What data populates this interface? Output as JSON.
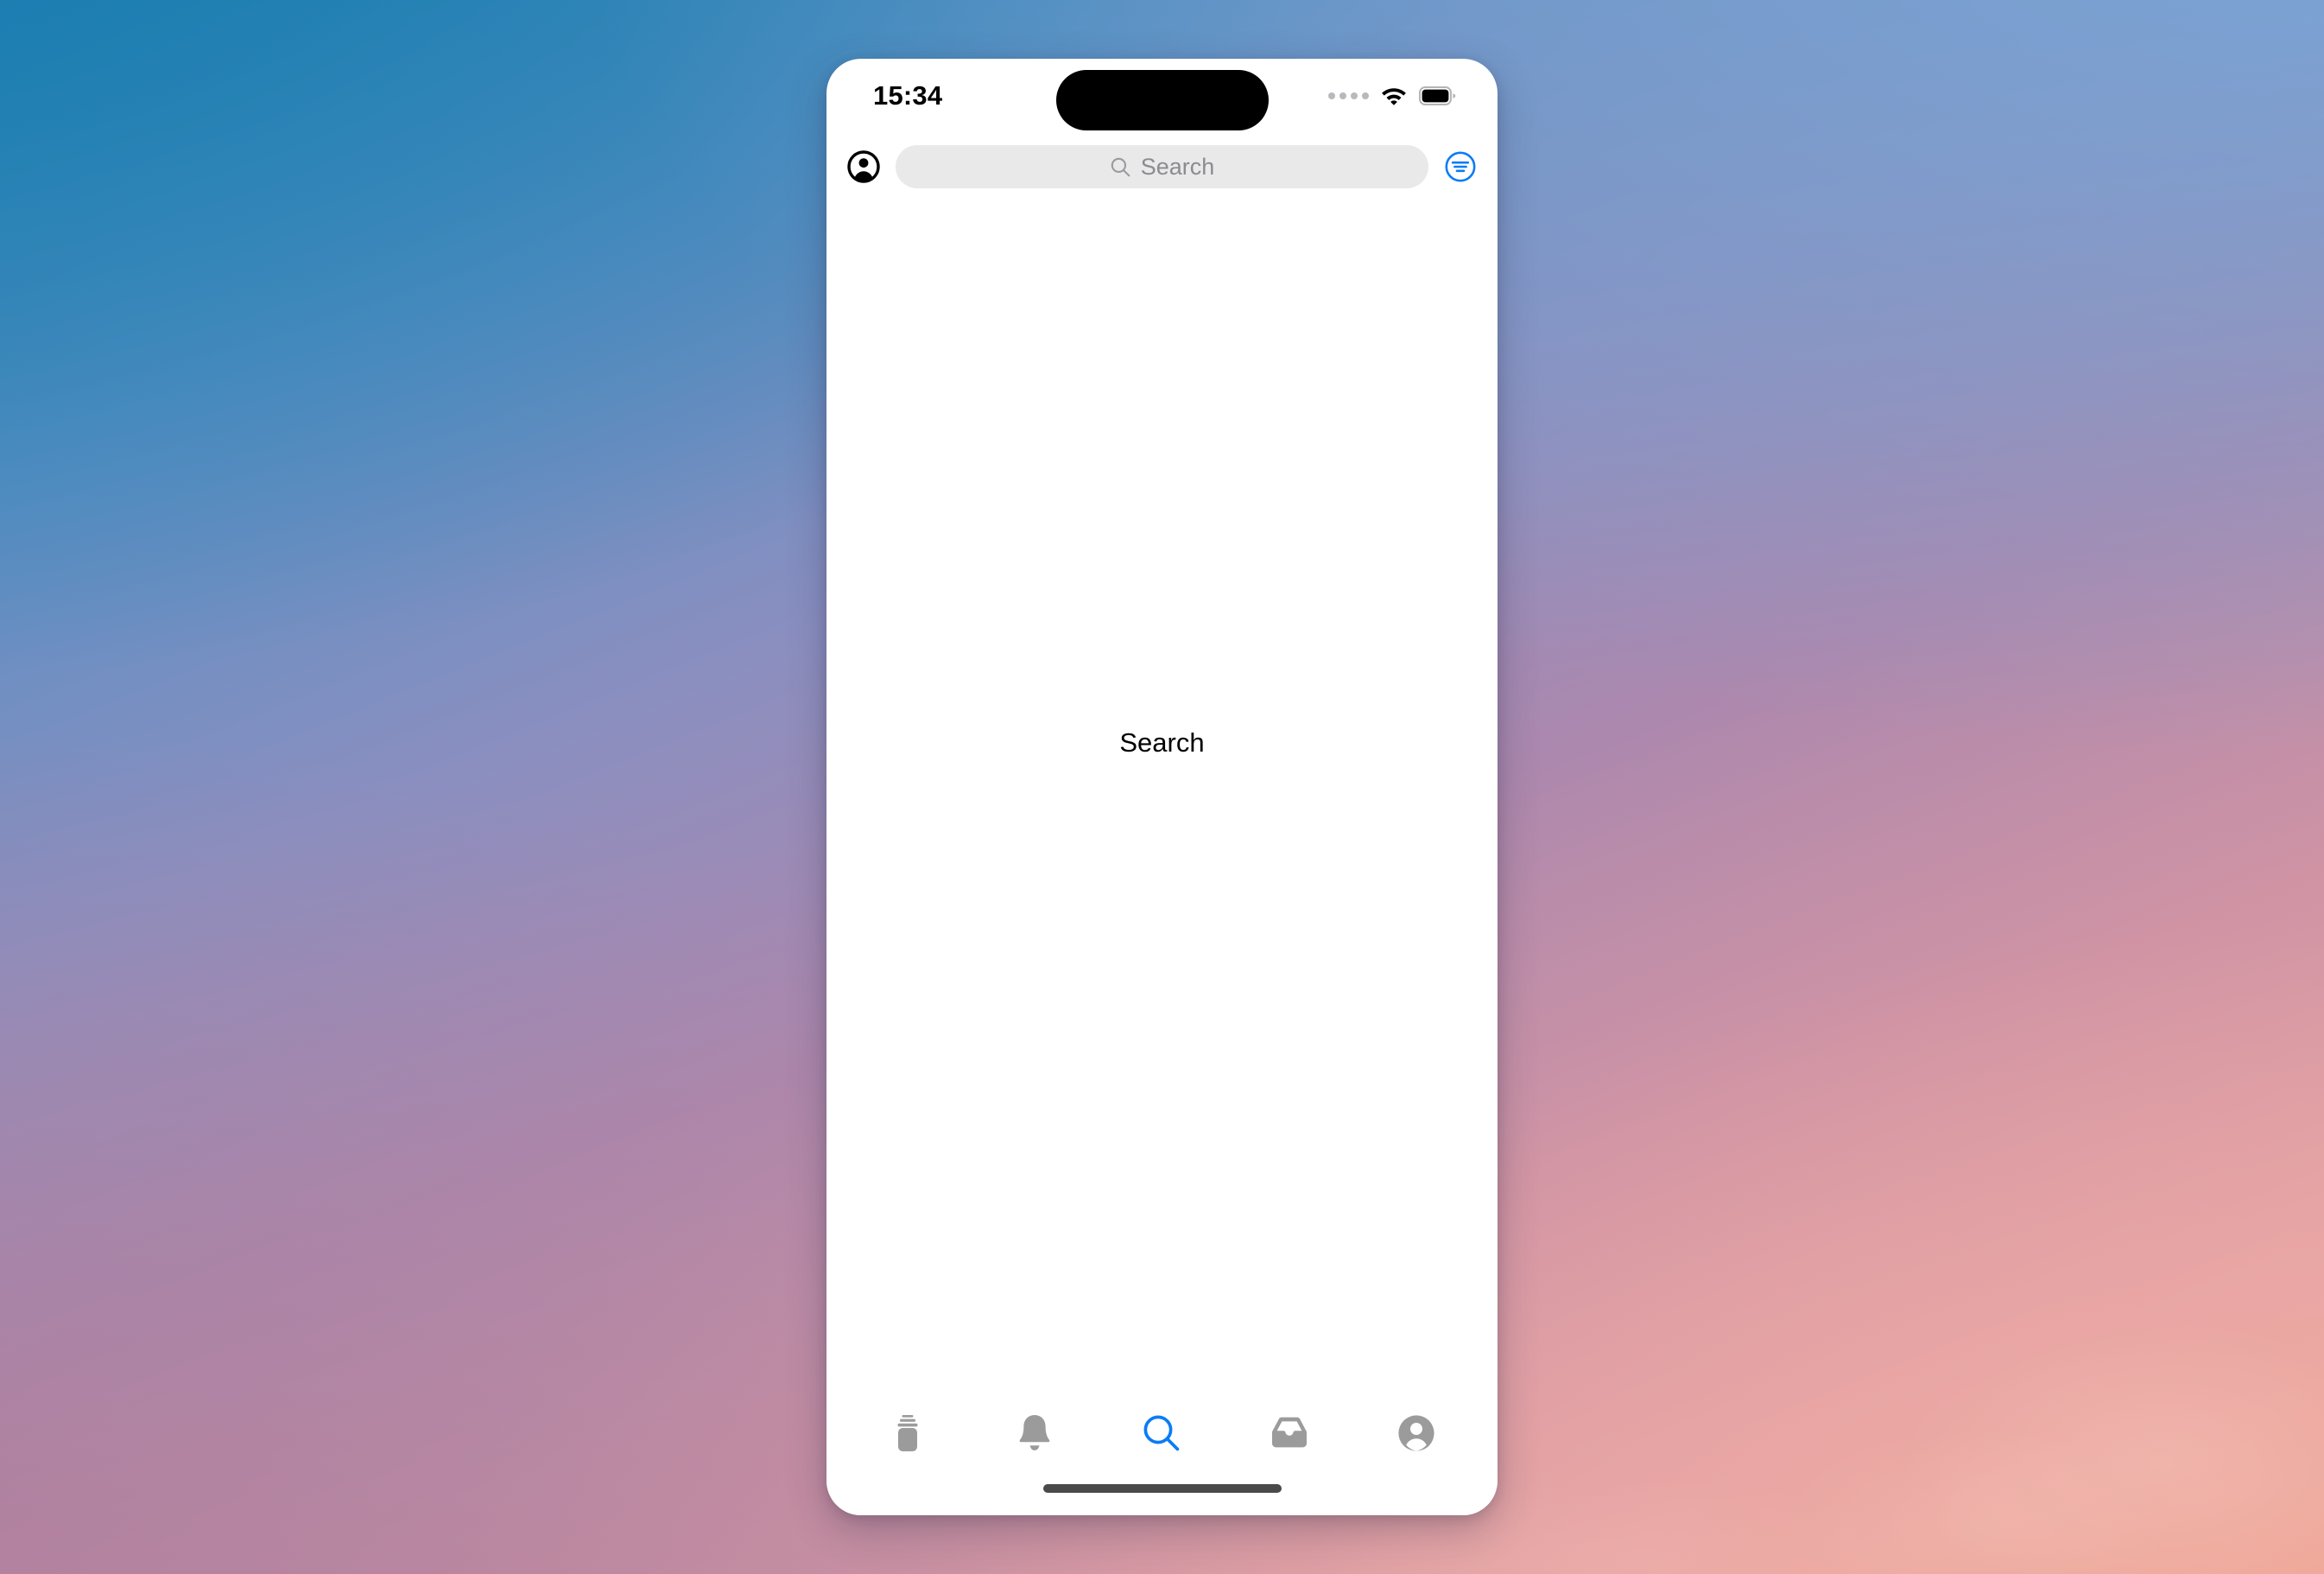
{
  "wallpaper": {
    "gradient_top_left": "#1a7cb0",
    "gradient_top_right": "#7aa5d6",
    "gradient_bottom_left": "#b0809a",
    "gradient_bottom_right": "#e5a29f"
  },
  "status_bar": {
    "time": "15:34",
    "signal_icon": "cellular-dots-icon",
    "signal_dots": 4,
    "wifi_icon": "wifi-icon",
    "battery_icon": "battery-full-icon",
    "dynamic_island": "dynamic-island"
  },
  "nav_bar": {
    "account_icon": "account-circle-icon",
    "account_label": "Account",
    "search": {
      "icon": "search-icon",
      "value": "",
      "placeholder": "Search"
    },
    "filter_icon": "filter-lines-circle-icon",
    "filter_label": "Filters",
    "accent_color": "#0b7cf5"
  },
  "content": {
    "title": "Search",
    "empty_state": true
  },
  "tab_bar": {
    "active_index": 2,
    "active_color": "#0b7cf5",
    "inactive_color": "#9b9b9b",
    "items": [
      {
        "id": "stack",
        "icon": "card-stack-icon",
        "label": "Stack",
        "active": false
      },
      {
        "id": "notifications",
        "icon": "bell-icon",
        "label": "Notifications",
        "active": false
      },
      {
        "id": "search",
        "icon": "search-icon",
        "label": "Search",
        "active": true
      },
      {
        "id": "inbox",
        "icon": "inbox-tray-icon",
        "label": "Inbox",
        "active": false
      },
      {
        "id": "profile",
        "icon": "person-circle-icon",
        "label": "Profile",
        "active": false
      }
    ]
  },
  "home_indicator": {
    "label": "Home indicator"
  }
}
